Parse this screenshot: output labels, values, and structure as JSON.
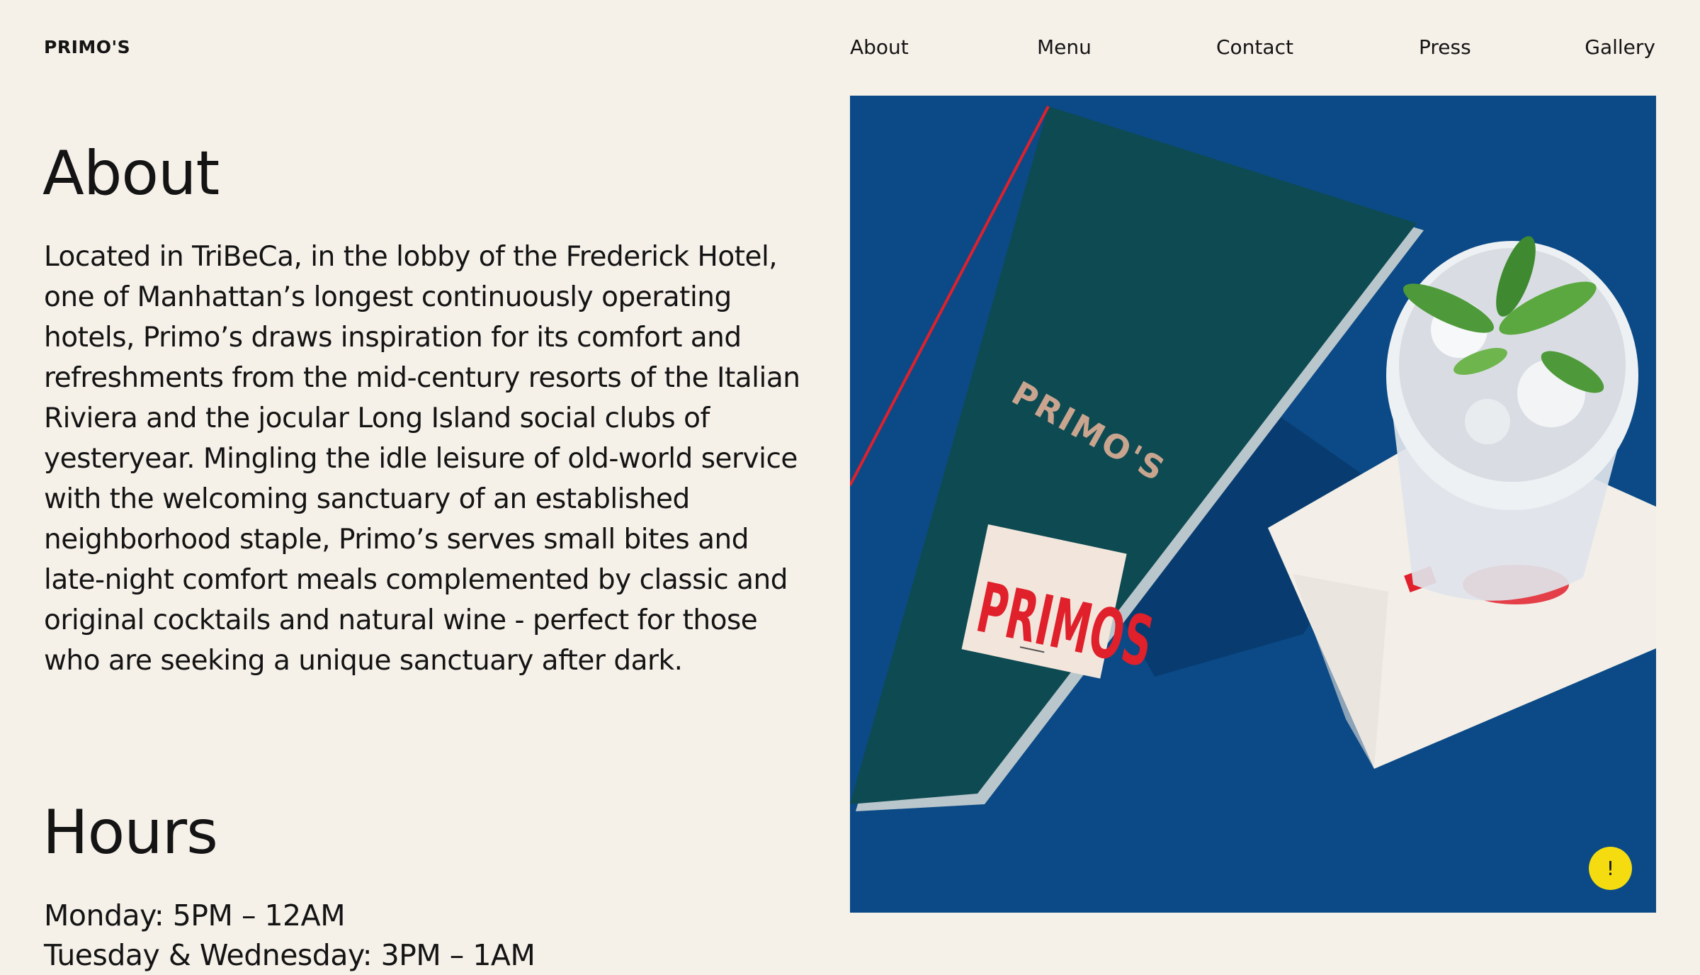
{
  "header": {
    "logo": "PRIMO'S",
    "nav": [
      "About",
      "Menu",
      "Contact",
      "Press",
      "Gallery"
    ]
  },
  "about": {
    "heading": "About",
    "body": "Located in TriBeCa, in the lobby of the Frederick Hotel, one of Manhattan’s longest continuously operating hotels, Primo’s draws inspiration for its comfort and refreshments from the mid-century resorts of the Italian Riviera and the jocular Long Island social clubs of yesteryear. Mingling the idle leisure of old-world service with the welcoming sanctuary of an established neighborhood staple, Primo’s serves small bites and late-night comfort meals complemented by classic and original cocktails and natural wine - perfect for those who are seeking a unique sanctuary after dark."
  },
  "hours": {
    "heading": "Hours",
    "items": [
      "Monday: 5PM – 12AM",
      "Tuesday & Wednesday: 3PM – 1AM"
    ]
  },
  "photo": {
    "menu_print": "PRIMO'S",
    "matchbook_print": "PRIMOS"
  },
  "feedback_button": {
    "label": "!"
  },
  "colors": {
    "background": "#f5f0e8",
    "text": "#141414",
    "photo_blue": "#0a4a86",
    "menu_teal": "#0e4a52",
    "accent_red": "#e0202b",
    "alert_yellow": "#f5dc10"
  }
}
